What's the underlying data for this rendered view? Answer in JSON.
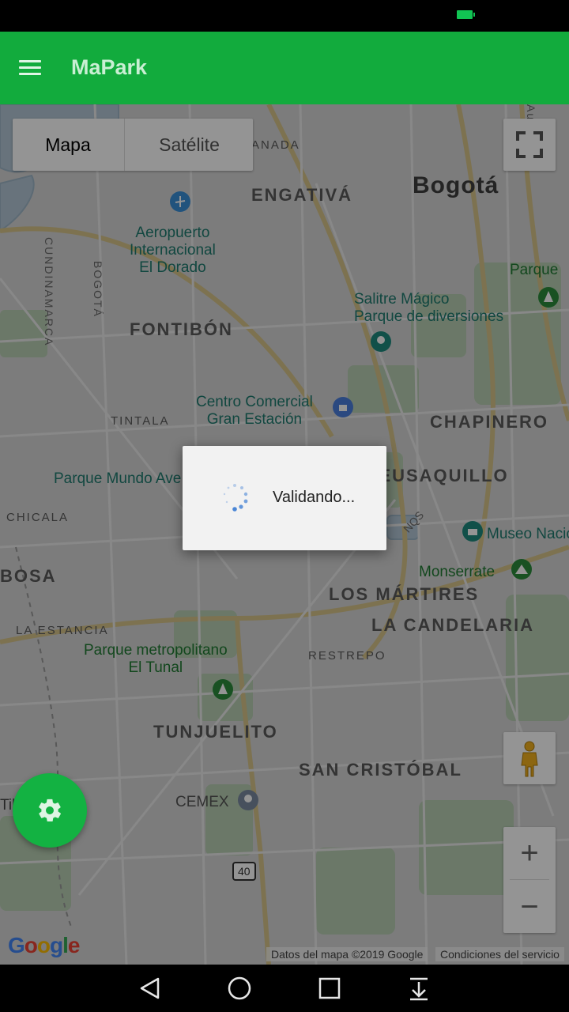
{
  "app": {
    "title": "MaPark"
  },
  "map_controls": {
    "map_type": {
      "options": [
        "Mapa",
        "Satélite"
      ],
      "selected": "Mapa"
    },
    "zoom_in": "+",
    "zoom_out": "−"
  },
  "map_labels": {
    "city": "Bogotá",
    "districts": [
      "ENGATIVÁ",
      "FONTIBÓN",
      "CHAPINERO",
      "TEUSAQUILLO",
      "LOS MÁRTIRES",
      "LA CANDELARIA",
      "BOSA",
      "TUNJUELITO",
      "SAN CRISTÓBAL"
    ],
    "small_districts": [
      "ANADA",
      "TINTALA",
      "CHICALA",
      "LA ESTANCIA",
      "RESTREPO"
    ],
    "vertical": [
      "CUNDINAMARCA",
      "BOGOTÁ",
      "Autopista"
    ],
    "pois": {
      "airport": "Aeropuerto\nInternacional\nEl Dorado",
      "salitre": "Salitre Mágico\nParque de diversiones",
      "centro_comercial": "Centro Comercial\nGran Estación",
      "parque_mundo": "Parque Mundo Aventura",
      "museo": "Museo Nacional",
      "monserrate": "Monserrate",
      "parque": "Parque",
      "tunal": "Parque metropolitano\nEl Tunal",
      "cemex": "CEMEX",
      "tibanica": "Tibanica",
      "road_sign": "40",
      "nqs": "NQS"
    }
  },
  "attribution": {
    "google_logo": "Google",
    "map_data": "Datos del mapa ©2019 Google",
    "terms": "Condiciones del servicio"
  },
  "dialog": {
    "message": "Validando..."
  },
  "icons": {
    "menu": "hamburger-menu-icon",
    "settings": "gear-icon",
    "fullscreen": "fullscreen-icon",
    "pegman": "street-view-pegman-icon",
    "spinner": "loading-spinner-icon",
    "nav_back": "triangle-back-icon",
    "nav_home": "circle-home-icon",
    "nav_recent": "square-recent-icon",
    "nav_notifications": "pull-down-icon"
  },
  "colors": {
    "appbar": "#12ab3d",
    "fab": "#13b242",
    "battery": "#11c453"
  }
}
